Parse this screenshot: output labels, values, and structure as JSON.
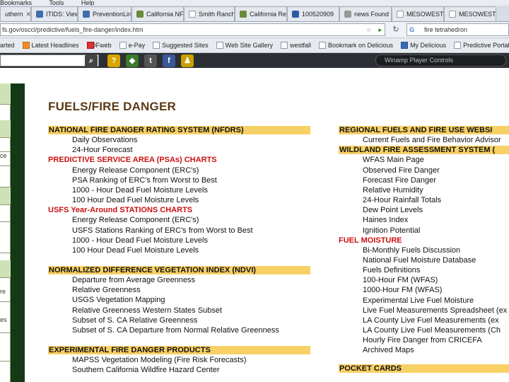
{
  "browser": {
    "menu": [
      "Bookmarks",
      "Tools",
      "Help"
    ],
    "tabs": [
      {
        "label": "uthern"
      },
      {
        "label": "ITIDS: View"
      },
      {
        "label": "PreventionLink"
      },
      {
        "label": "California NF"
      },
      {
        "label": "Smith Ranch"
      },
      {
        "label": "California Re"
      },
      {
        "label": "100520909"
      },
      {
        "label": "news Found"
      },
      {
        "label": "MESOWEST"
      },
      {
        "label": "MESOWEST"
      }
    ],
    "url": "fs.gov/osccl/predictive/fuels_fire-danger/index.htm",
    "search_value": "fire tetrahedron",
    "bookmarks": [
      {
        "label": "arted",
        "icon": "page-icon"
      },
      {
        "label": "Latest Headlines",
        "icon": "rss-icon"
      },
      {
        "label": "CDFweb",
        "icon": "cdf-icon"
      },
      {
        "label": "e-Pay",
        "icon": "page-icon"
      },
      {
        "label": "Suggested Sites",
        "icon": "page-icon"
      },
      {
        "label": "Web Site Gallery",
        "icon": "page-icon"
      },
      {
        "label": "westfall",
        "icon": "page-icon"
      },
      {
        "label": "Bookmark on Delicious",
        "icon": "page-icon"
      },
      {
        "label": "My Delicious",
        "icon": "delicious-icon"
      },
      {
        "label": "Predictive Portal",
        "icon": "page-icon"
      }
    ],
    "winamp": "Winamp Player Controls"
  },
  "page": {
    "title": "FUELS/FIRE DANGER",
    "left_col": [
      {
        "type": "hdr",
        "text": "NATIONAL FIRE DANGER RATING SYSTEM (NFDRS)"
      },
      {
        "type": "item",
        "text": "Daily Observations"
      },
      {
        "type": "item",
        "text": "24-Hour Forecast"
      },
      {
        "type": "red",
        "text": "PREDICTIVE SERVICE AREA (PSAs) CHARTS"
      },
      {
        "type": "item",
        "text": "Energy Release Component (ERC's)"
      },
      {
        "type": "item",
        "text": "PSA Ranking of ERC's from Worst to Best"
      },
      {
        "type": "item",
        "text": "1000 - Hour Dead Fuel Moisture Levels"
      },
      {
        "type": "item",
        "text": "100 Hour Dead Fuel Moisture Levels"
      },
      {
        "type": "red",
        "text": "USFS Year-Around STATIONS CHARTS"
      },
      {
        "type": "item",
        "text": "Energy Release Component (ERC's)"
      },
      {
        "type": "item",
        "text": "USFS Stations Ranking of ERC's from Worst to Best"
      },
      {
        "type": "item",
        "text": "1000 - Hour Dead Fuel Moisture Levels"
      },
      {
        "type": "item",
        "text": "100 Hour Dead Fuel Moisture Levels"
      },
      {
        "type": "hdr",
        "text": "NORMALIZED DIFFERENCE VEGETATION INDEX (NDVI)"
      },
      {
        "type": "item",
        "text": "Departure from Average Greenness"
      },
      {
        "type": "item",
        "text": "Relative Greenness"
      },
      {
        "type": "item",
        "text": "USGS Vegetation Mapping"
      },
      {
        "type": "item",
        "text": "Relative Greenness Western States Subset"
      },
      {
        "type": "item",
        "text": "Subset of S. CA Relative Greenness"
      },
      {
        "type": "item",
        "text": "Subset of S. CA Departure from Normal Relative Greenness"
      },
      {
        "type": "hdr",
        "text": "EXPERIMENTAL FIRE DANGER PRODUCTS"
      },
      {
        "type": "item",
        "text": "MAPSS Vegetation Modeling (Fire Risk Forecasts)"
      },
      {
        "type": "item",
        "text": "Southern California Wildfire Hazard Center"
      }
    ],
    "right_col": [
      {
        "type": "hdr",
        "text": "REGIONAL FUELS AND FIRE USE WEBSI"
      },
      {
        "type": "item",
        "text": "Current Fuels and Fire Behavior Advisor"
      },
      {
        "type": "hdr",
        "text": "WILDLAND FIRE ASSESSMENT SYSTEM ("
      },
      {
        "type": "item",
        "text": "WFAS Main Page"
      },
      {
        "type": "item",
        "text": "Observed Fire Danger"
      },
      {
        "type": "item",
        "text": "Forecast Fire Danger"
      },
      {
        "type": "item",
        "text": "Relative Humidity"
      },
      {
        "type": "item",
        "text": "24-Hour Rainfall Totals"
      },
      {
        "type": "item",
        "text": "Dew Point Levels"
      },
      {
        "type": "item",
        "text": "Haines Index"
      },
      {
        "type": "item",
        "text": "Ignition Potential"
      },
      {
        "type": "red",
        "text": "FUEL MOISTURE"
      },
      {
        "type": "item",
        "text": "Bi-Monthly Fuels Discussion"
      },
      {
        "type": "item",
        "text": "National Fuel Moisture Database"
      },
      {
        "type": "item",
        "text": "Fuels Definitions"
      },
      {
        "type": "item",
        "text": "100-Hour FM (WFAS)"
      },
      {
        "type": "item",
        "text": "1000-Hour FM (WFAS)"
      },
      {
        "type": "item",
        "text": "Experimental Live Fuel Moisture"
      },
      {
        "type": "item",
        "text": "Live Fuel Measurements Spreadsheet (ex"
      },
      {
        "type": "item",
        "text": "LA County Live Fuel Measurements (ex"
      },
      {
        "type": "item",
        "text": "LA County Live Fuel Measurements (Ch"
      },
      {
        "type": "item",
        "text": "Hourly Fire Danger from CRICEFA"
      },
      {
        "type": "item",
        "text": "Archived Maps"
      },
      {
        "type": "hdr",
        "text": "POCKET CARDS"
      }
    ],
    "left_nav": [
      "",
      "",
      "",
      "ce",
      "",
      "",
      "",
      "re",
      "",
      "es",
      ""
    ]
  }
}
